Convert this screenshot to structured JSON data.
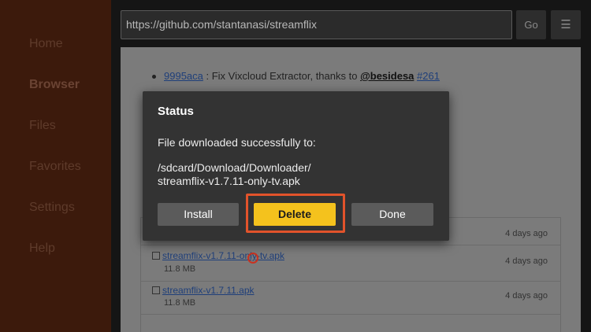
{
  "sidebar": {
    "items": [
      {
        "label": "Home"
      },
      {
        "label": "Browser"
      },
      {
        "label": "Files"
      },
      {
        "label": "Favorites"
      },
      {
        "label": "Settings"
      },
      {
        "label": "Help"
      }
    ],
    "active": "Browser"
  },
  "toolbar": {
    "url": "https://github.com/stantanasi/streamflix",
    "go_label": "Go",
    "menu_icon": "☰"
  },
  "webpage": {
    "commit_hash": "9995aca",
    "commit_text": " : Fix Vixcloud Extractor, thanks to ",
    "commit_user": "@besidesa",
    "commit_issue": "#261",
    "assets": [
      {
        "name": "",
        "size": "",
        "date": "4 days ago"
      },
      {
        "name": "streamflix-v1.7.11-only-tv.apk",
        "size": "11.8 MB",
        "date": "4 days ago"
      },
      {
        "name": "streamflix-v1.7.11.apk",
        "size": "11.8 MB",
        "date": "4 days ago"
      }
    ]
  },
  "dialog": {
    "title": "Status",
    "message": "File downloaded successfully to:",
    "path_line1": "/sdcard/Download/Downloader/",
    "path_line2": "streamflix-v1.7.11-only-tv.apk",
    "install_label": "Install",
    "delete_label": "Delete",
    "done_label": "Done"
  },
  "colors": {
    "sidebar_bg": "#3c1a0c",
    "delete_button": "#f4c21d",
    "highlight_border": "#e2532b",
    "dialog_bg": "#333333"
  }
}
